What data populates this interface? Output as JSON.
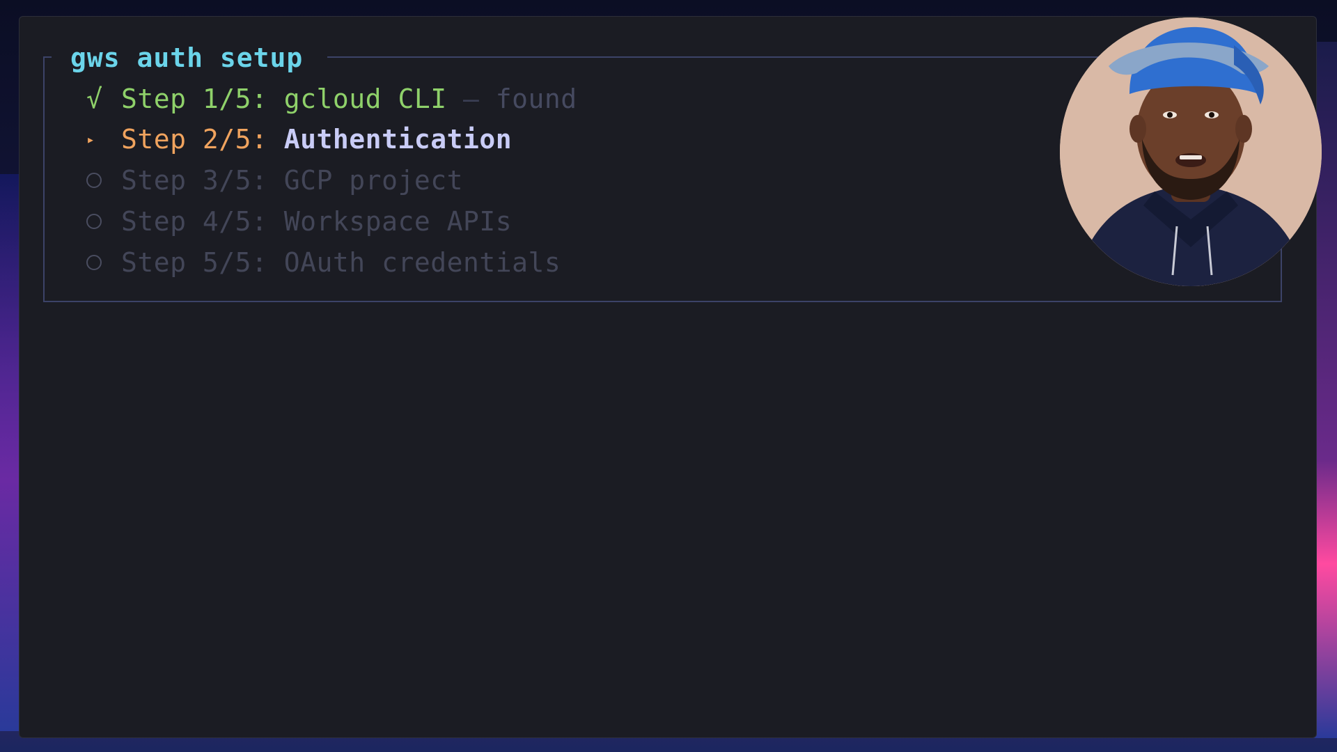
{
  "terminal": {
    "panel_title": "gws auth setup",
    "steps": [
      {
        "marker": "√",
        "label": "Step 1/5:",
        "name": "gcloud CLI",
        "separator": "—",
        "note": "found",
        "state": "done"
      },
      {
        "marker": "▸",
        "label": "Step 2/5:",
        "name": "Authentication",
        "state": "active"
      },
      {
        "label": "Step 3/5:",
        "name": "GCP project",
        "state": "pending"
      },
      {
        "label": "Step 4/5:",
        "name": "Workspace APIs",
        "state": "pending"
      },
      {
        "label": "Step 5/5:",
        "name": "OAuth credentials",
        "state": "pending"
      }
    ]
  },
  "colors": {
    "title": "#6bd4ea",
    "done": "#8fd16a",
    "active": "#f0a35e",
    "active_name": "#c9ccf6",
    "pending": "#434658",
    "panel_border": "#3c4368",
    "terminal_bg": "#1b1c23"
  },
  "presenter_overlay": {
    "icon": "presenter-avatar"
  }
}
